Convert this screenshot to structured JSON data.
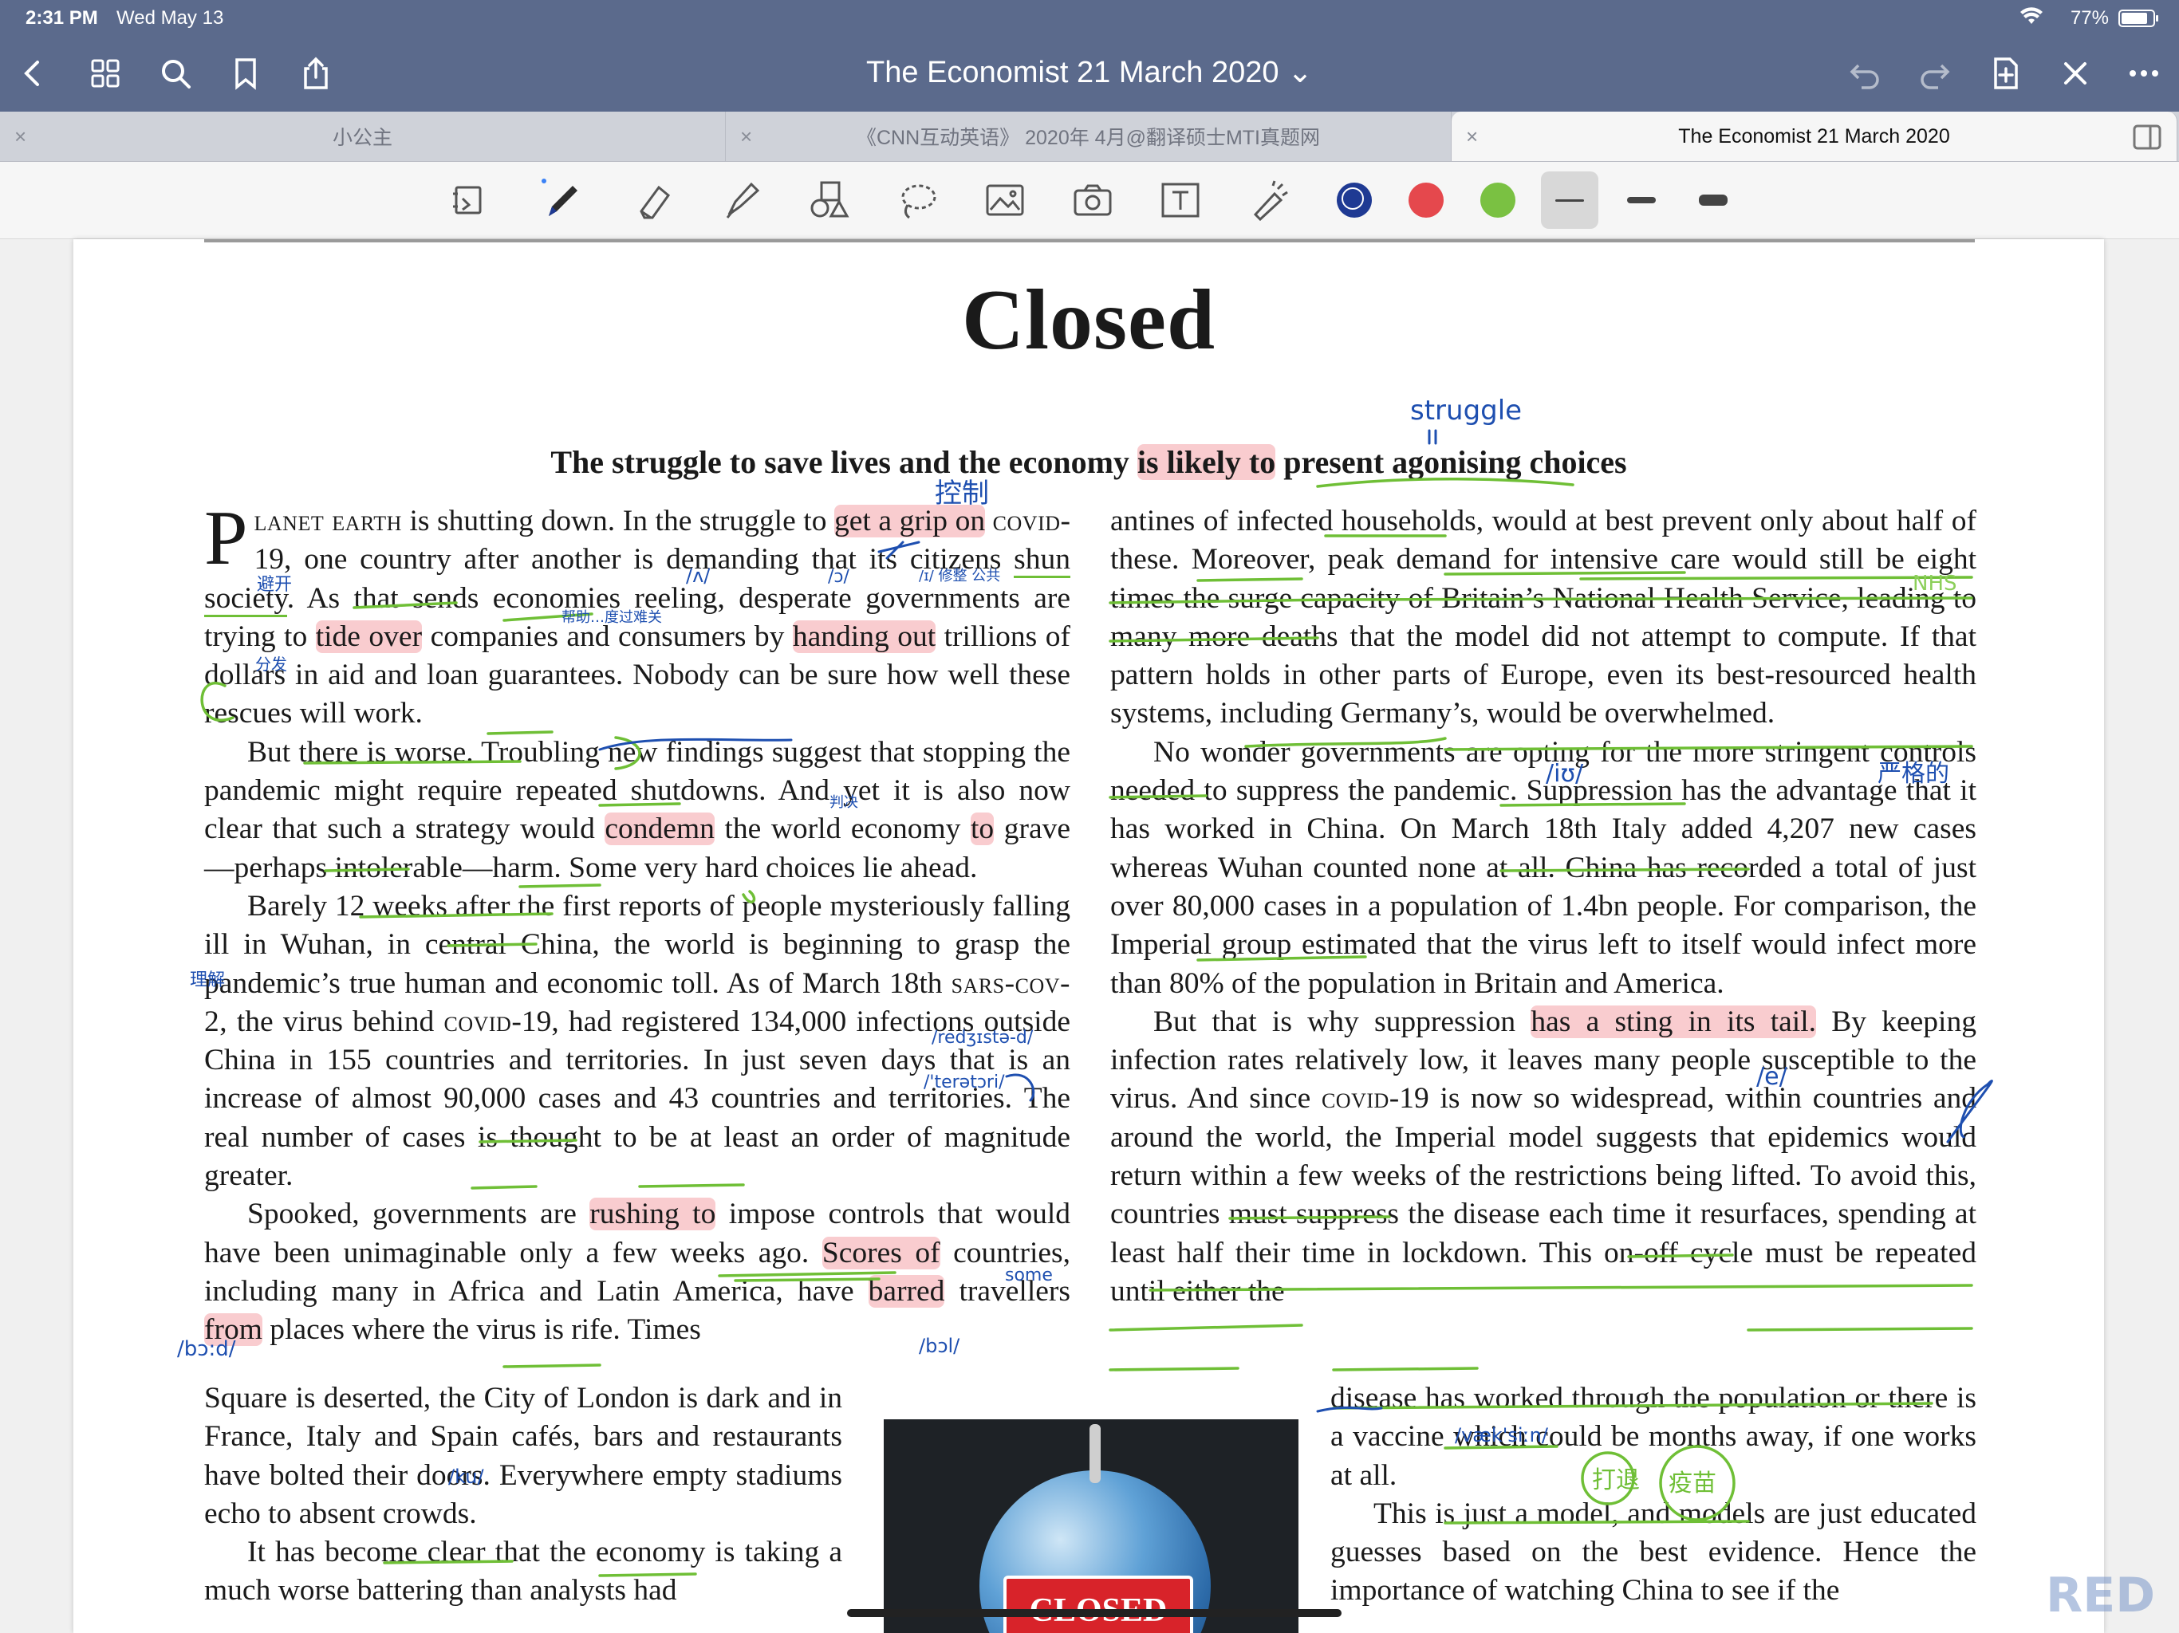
{
  "status": {
    "time": "2:31 PM",
    "date": "Wed May 13",
    "battery": "77%"
  },
  "nav": {
    "title": "The Economist 21 March 2020",
    "left_icons": [
      "back-icon",
      "grid-icon",
      "search-icon",
      "bookmark-icon",
      "share-icon"
    ],
    "right_icons": [
      "undo-icon",
      "redo-icon",
      "add-page-icon",
      "close-icon",
      "more-icon"
    ]
  },
  "tabs": [
    {
      "label": "小公主"
    },
    {
      "label": "《CNN互动英语》 2020年 4月@翻译硕士MTI真题网"
    },
    {
      "label": "The Economist 21 March 2020"
    }
  ],
  "toolbar": {
    "tools": [
      "read-mode-icon",
      "pen-icon",
      "eraser-icon",
      "highlighter-icon",
      "shapes-icon",
      "lasso-icon",
      "image-icon",
      "camera-icon",
      "textbox-icon",
      "laser-pointer-icon"
    ],
    "colors": [
      "#1f3a93",
      "#e5484d",
      "#7ac142"
    ],
    "selected_color": "#1f3a93",
    "stroke_widths": [
      "thin",
      "medium",
      "thick"
    ],
    "selected_stroke": "thin"
  },
  "article": {
    "headline": "Closed",
    "subhead": {
      "a": "The struggle to save lives and the economy ",
      "b": "is likely to",
      "c": " present agonising choices"
    },
    "p1": {
      "cap": "P",
      "sc": "lanet earth",
      "t1": " is shutting down. In the struggle to ",
      "h1": "get a grip on",
      "t2": " ",
      "sc2": "covid",
      "t3": "-19, one country after another is demanding that its citizens ",
      "u1": "shun society",
      "t4": ". As that sends economies reeling, desperate governments are trying to ",
      "h2": "tide over",
      "t5": " companies and consumers by ",
      "h3": "handing out",
      "t6": " trillions of dollars in aid and loan guarantees. Nobody can be sure how well these rescues will work."
    },
    "p2": {
      "t1": "But there is worse. Troubling new findings suggest that stopping the pandemic might require repeated shutdowns. And yet it is also now clear that such a strategy would ",
      "h1": "condemn",
      "t2": " the world economy ",
      "h2": "to",
      "t3": " grave—perhaps intolerable—harm. Some very hard choices lie ahead."
    },
    "p3": {
      "t1": "Barely 12 weeks after the first reports of people mysteriously falling ill in Wuhan, in central China, the world is beginning to grasp the pandemic’s true human and economic toll. As of March 18th ",
      "sc1": "sars-cov-2",
      "t2": ", the virus behind ",
      "sc2": "covid",
      "t3": "-19, had registered 134,000 infections outside China in 155 countries and territories. In just seven days that is an increase of almost 90,000 cases and 43 countries and territories. The real number of cases is thought to be at least an order of magnitude greater."
    },
    "p4": {
      "t1": "Spooked, governments are ",
      "h1": "rushing to",
      "t2": " impose controls that would have been unimaginable only a few weeks ago. ",
      "h2": "Scores of",
      "t3": " countries, including many in Africa and Latin America, have ",
      "h3": "barred",
      "t4": " travellers ",
      "h4": "from",
      "t5": " places where the virus is rife. Times"
    },
    "colA2": {
      "p4end": "Square is deserted, the City of London is dark and in France, Italy and Spain cafés, bars and restaurants have bolted their doors. Everywhere empty stadiums echo to absent crowds.",
      "p5": "It has become clear that the economy is taking a much worse battering than analysts had"
    },
    "colB": {
      "p1": "antines of infected households, would at best prevent only about half of these. Moreover, peak demand for intensive care would still be eight times the surge capacity of Britain’s National Health Service, leading to many more deaths that the model did not attempt to compute. If that pattern holds in other parts of Europe, even its best-resourced health systems, including Germany’s, would be overwhelmed.",
      "p2a": "No wonder governments are opting for the more stringent controls needed to suppress the pandemic. Suppression has the advantage that it has worked in China. On March 18th Italy added 4,207 new cases whereas Wuhan counted none at all. China has recorded a total of just over 80,000 cases in a population of 1.4bn people. For comparison, the Imperial group estimated that the virus left to itself would infect more than 80% of the population in Britain and America.",
      "p3a": "But that is why suppression ",
      "p3h": "has a sting in its tail.",
      "p3b": " By keeping infection rates relatively low, it leaves many people susceptible to the virus. And since ",
      "p3sc": "covid",
      "p3c": "-19 is now so widespread, within countries and around the world, the Imperial model suggests that epidemics would return within a few weeks of the restrictions being lifted. To avoid this, countries must suppress the disease each time it resurfaces, spending at least half their time in lockdown. This on-off cycle must be repeated until either the"
    },
    "colB2": {
      "p3end": "disease has worked through the population or there is a vaccine which could be months away, if one works at all.",
      "p4": "This is just a model, and models are just educated guesses based on the best evidence. Hence the importance of watching China to see if the"
    },
    "photo_sign": "CLOSED"
  },
  "annotations": {
    "struggle": "struggle",
    "struggle_mark": "||",
    "kongzhi": "控制",
    "bizhi": "避开",
    "dujian": "帮助…度过难关",
    "fenfa": "分发",
    "panjue": "判决",
    "lijie": "理解",
    "redzhisterd": "/redʒɪstə-d/",
    "teratori": "/'terətɔri/",
    "some": "some",
    "bo": "/bɔ:d/",
    "ku": "/ku/",
    "bo2": "/bɔl/",
    "ou": "/ɔ/",
    "sl": "/ʌ/",
    "lijie_ri": "/ɪ/ 修整 公共",
    "nhs": "NHS",
    "yange": "严格的",
    "iu": "/iʊ/",
    "ee": "/e/",
    "vaksin": "/væk'siːn/",
    "yimiao": "疫苗",
    "jijie": "打退",
    "watermark": "RED"
  }
}
